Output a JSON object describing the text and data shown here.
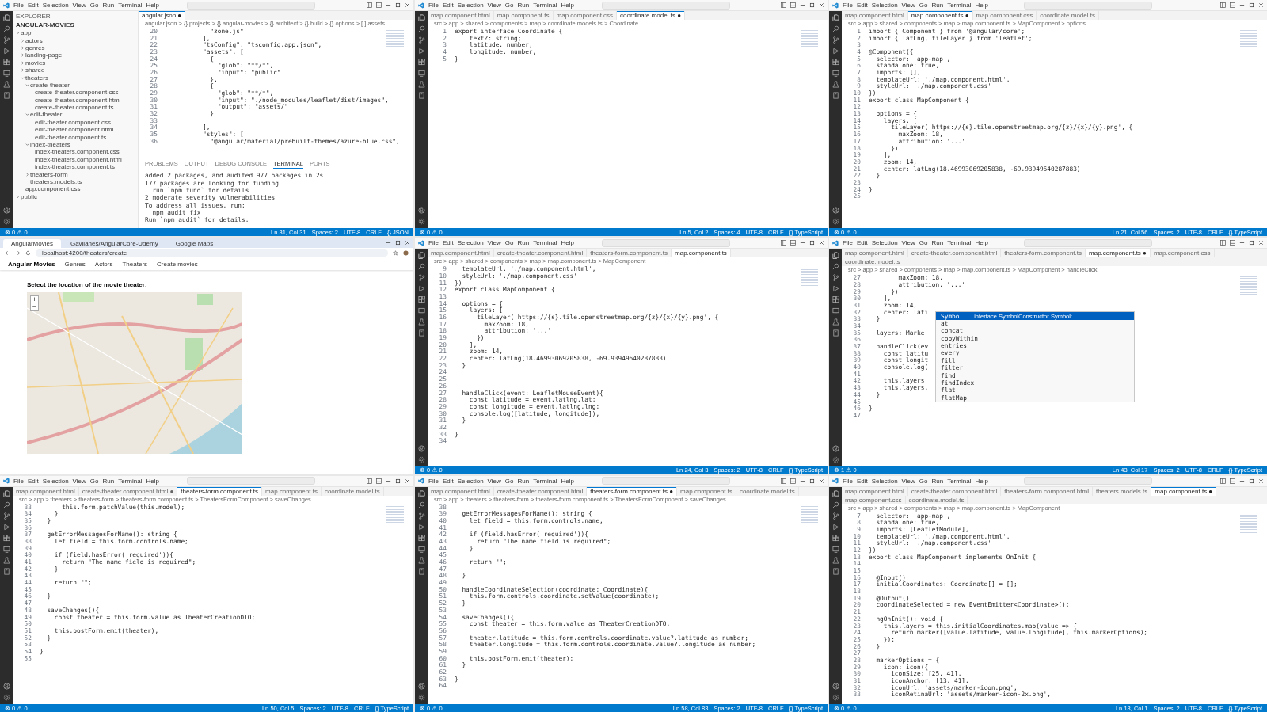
{
  "tiles": [
    {
      "kind": "editor",
      "menu": [
        "File",
        "Edit",
        "Selection",
        "View",
        "Go",
        "Run",
        "Terminal",
        "Help"
      ],
      "sidebar": {
        "title": "EXPLORER",
        "root": "ANGULAR-MOVIES",
        "items": [
          {
            "label": "app",
            "expanded": true,
            "children": [
              {
                "label": "actors",
                "expanded": false
              },
              {
                "label": "genres",
                "expanded": false
              },
              {
                "label": "landing-page",
                "expanded": false
              },
              {
                "label": "movies",
                "expanded": false
              },
              {
                "label": "shared",
                "expanded": false
              },
              {
                "label": "theaters",
                "expanded": true,
                "children": [
                  {
                    "label": "create-theater",
                    "expanded": true,
                    "children": [
                      {
                        "label": "create-theater.component.css"
                      },
                      {
                        "label": "create-theater.component.html"
                      },
                      {
                        "label": "create-theater.component.ts"
                      }
                    ]
                  },
                  {
                    "label": "edit-theater",
                    "expanded": true,
                    "children": [
                      {
                        "label": "edit-theater.component.css"
                      },
                      {
                        "label": "edit-theater.component.html"
                      },
                      {
                        "label": "edit-theater.component.ts"
                      }
                    ]
                  },
                  {
                    "label": "index-theaters",
                    "expanded": true,
                    "children": [
                      {
                        "label": "index-theaters.component.css"
                      },
                      {
                        "label": "index-theaters.component.html"
                      },
                      {
                        "label": "index-theaters.component.ts"
                      }
                    ]
                  },
                  {
                    "label": "theaters-form",
                    "expanded": false
                  },
                  {
                    "label": "theaters.models.ts"
                  }
                ]
              },
              {
                "label": "app.component.css"
              }
            ]
          },
          {
            "label": "public",
            "expanded": false
          }
        ]
      },
      "tabs": [
        {
          "label": "angular.json ●",
          "selected": true
        }
      ],
      "breadcrumb": "angular.json > {} projects > {} angular-movies > {} architect > {} build > {} options > [ ] assets",
      "lines": [
        {
          "n": "20",
          "text": "            \"zone.js\""
        },
        {
          "n": "21",
          "text": "          ],"
        },
        {
          "n": "22",
          "text": "          \"tsConfig\": \"tsconfig.app.json\","
        },
        {
          "n": "23",
          "text": "          \"assets\": ["
        },
        {
          "n": "24",
          "text": "            {"
        },
        {
          "n": "25",
          "text": "              \"glob\": \"**/*\","
        },
        {
          "n": "26",
          "text": "              \"input\": \"public\""
        },
        {
          "n": "27",
          "text": "            },"
        },
        {
          "n": "28",
          "text": "            {"
        },
        {
          "n": "29",
          "text": "              \"glob\": \"**/*\","
        },
        {
          "n": "30",
          "text": "              \"input\": \"./node_modules/leaflet/dist/images\","
        },
        {
          "n": "31",
          "text": "              \"output\": \"assets/\""
        },
        {
          "n": "32",
          "text": "            }"
        },
        {
          "n": "33"
        },
        {
          "n": "34",
          "text": "          ],"
        },
        {
          "n": "35",
          "text": "          \"styles\": ["
        },
        {
          "n": "36",
          "text": "            \"@angular/material/prebuilt-themes/azure-blue.css\","
        }
      ],
      "panel": {
        "tabs": [
          {
            "label": "PROBLEMS",
            "selected": false
          },
          {
            "label": "OUTPUT",
            "selected": false
          },
          {
            "label": "DEBUG CONSOLE",
            "selected": false
          },
          {
            "label": "TERMINAL",
            "selected": true
          },
          {
            "label": "PORTS",
            "selected": false
          }
        ],
        "lines": [
          "added 2 packages, and audited 977 packages in 2s",
          "177 packages are looking for funding",
          "  run `npm fund` for details",
          "2 moderate severity vulnerabilities",
          "To address all issues, run:",
          "  npm audit fix",
          "Run `npm audit` for details."
        ]
      },
      "status_left": [
        "⊗ 0 ⚠ 0"
      ],
      "status_right": [
        "Ln 31, Col 31",
        "Spaces: 2",
        "UTF-8",
        "CRLF",
        "{} JSON"
      ]
    },
    {
      "kind": "editor",
      "menu": [
        "File",
        "Edit",
        "Selection",
        "View",
        "Go",
        "Run",
        "Terminal",
        "Help"
      ],
      "tabs": [
        {
          "label": "map.component.html",
          "selected": false
        },
        {
          "label": "map.component.ts",
          "selected": false
        },
        {
          "label": "map.component.css",
          "selected": false
        },
        {
          "label": "coordinate.model.ts ●",
          "selected": true
        }
      ],
      "breadcrumb": "src > app > shared > components > map > coordinate.models.ts > Coordinate",
      "lines": [
        {
          "n": "1",
          "text": "export interface Coordinate {"
        },
        {
          "n": "2",
          "text": "    text?: string;"
        },
        {
          "n": "3",
          "text": "    latitude: number;"
        },
        {
          "n": "4",
          "text": "    longitude: number;"
        },
        {
          "n": "5",
          "text": "}"
        }
      ],
      "status_left": [
        "⊗ 0 ⚠ 0"
      ],
      "status_right": [
        "Ln 5, Col 2",
        "Spaces: 4",
        "UTF-8",
        "CRLF",
        "{} TypeScript"
      ]
    },
    {
      "kind": "editor",
      "menu": [
        "File",
        "Edit",
        "Selection",
        "View",
        "Go",
        "Run",
        "Terminal",
        "Help"
      ],
      "tabs": [
        {
          "label": "map.component.html",
          "selected": false
        },
        {
          "label": "map.component.ts ●",
          "selected": true
        },
        {
          "label": "map.component.css",
          "selected": false
        },
        {
          "label": "coordinate.model.ts",
          "selected": false
        }
      ],
      "breadcrumb": "src > app > shared > components > map > map.component.ts > MapComponent > options",
      "lines": [
        {
          "n": "1",
          "text": "import { Component } from '@angular/core';"
        },
        {
          "n": "2",
          "text": "import { latLng, tileLayer } from 'leaflet';"
        },
        {
          "n": "3"
        },
        {
          "n": "4",
          "text": "@Component({"
        },
        {
          "n": "5",
          "text": "  selector: 'app-map',"
        },
        {
          "n": "6",
          "text": "  standalone: true,"
        },
        {
          "n": "7",
          "text": "  imports: [],"
        },
        {
          "n": "8",
          "text": "  templateUrl: './map.component.html',"
        },
        {
          "n": "9",
          "text": "  styleUrl: './map.component.css'"
        },
        {
          "n": "10",
          "text": "})"
        },
        {
          "n": "11",
          "text": "export class MapComponent {"
        },
        {
          "n": "12"
        },
        {
          "n": "13",
          "text": "  options = {"
        },
        {
          "n": "14",
          "text": "    layers: ["
        },
        {
          "n": "15",
          "text": "      tileLayer('https://{s}.tile.openstreetmap.org/{z}/{x}/{y}.png', {"
        },
        {
          "n": "16",
          "text": "        maxZoom: 18,"
        },
        {
          "n": "17",
          "text": "        attribution: '...'"
        },
        {
          "n": "18",
          "text": "      })"
        },
        {
          "n": "19",
          "text": "    ],"
        },
        {
          "n": "20",
          "text": "    zoom: 14,"
        },
        {
          "n": "21",
          "text": "    center: latLng(18.46993069205838, -69.93949640287883)"
        },
        {
          "n": "22",
          "text": "  }"
        },
        {
          "n": "23"
        },
        {
          "n": "24",
          "text": "}"
        },
        {
          "n": "25"
        }
      ],
      "status_left": [
        "⊗ 0 ⚠ 0"
      ],
      "status_right": [
        "Ln 21, Col 56",
        "Spaces: 2",
        "UTF-8",
        "CRLF",
        "{} TypeScript"
      ]
    },
    {
      "kind": "browser",
      "tabs": [
        {
          "label": "AngularMovies",
          "selected": true
        },
        {
          "label": "Gavilanes/AngularCore-Udemy",
          "selected": false
        },
        {
          "label": "Google Maps",
          "selected": false
        }
      ],
      "url": "localhost:4200/theaters/create",
      "brand": "Angular Movies",
      "nav": [
        "Genres",
        "Actors",
        "Theaters",
        "Create movies"
      ],
      "heading": "Select the location of the movie theater:",
      "zoom_controls": [
        "+",
        "−"
      ]
    },
    {
      "kind": "editor",
      "menu": [
        "File",
        "Edit",
        "Selection",
        "View",
        "Go",
        "Run",
        "Terminal",
        "Help"
      ],
      "tabs": [
        {
          "label": "map.component.html",
          "selected": false
        },
        {
          "label": "create-theater.component.html",
          "selected": false
        },
        {
          "label": "theaters-form.component.ts",
          "selected": false
        },
        {
          "label": "map.component.ts",
          "selected": true
        }
      ],
      "breadcrumb": "src > app > shared > components > map > map.component.ts > MapComponent",
      "lines": [
        {
          "n": "9",
          "text": "  templateUrl: './map.component.html',"
        },
        {
          "n": "10",
          "text": "  styleUrl: './map.component.css'"
        },
        {
          "n": "11",
          "text": "})"
        },
        {
          "n": "12",
          "text": "export class MapComponent {"
        },
        {
          "n": "13"
        },
        {
          "n": "14",
          "text": "  options = {"
        },
        {
          "n": "15",
          "text": "    layers: ["
        },
        {
          "n": "16",
          "text": "      tileLayer('https://{s}.tile.openstreetmap.org/{z}/{x}/{y}.png', {"
        },
        {
          "n": "17",
          "text": "        maxZoom: 18,"
        },
        {
          "n": "18",
          "text": "        attribution: '...'"
        },
        {
          "n": "19",
          "text": "      })"
        },
        {
          "n": "20",
          "text": "    ],"
        },
        {
          "n": "21",
          "text": "    zoom: 14,"
        },
        {
          "n": "22",
          "text": "    center: latLng(18.46993069205838, -69.93949640287883)"
        },
        {
          "n": "23",
          "text": "  }"
        },
        {
          "n": "24"
        },
        {
          "n": "25"
        },
        {
          "n": "26"
        },
        {
          "n": "27",
          "text": "  handleClick(event: LeafletMouseEvent){"
        },
        {
          "n": "28",
          "text": "    const latitude = event.latlng.lat;"
        },
        {
          "n": "29",
          "text": "    const longitude = event.latlng.lng;"
        },
        {
          "n": "30",
          "text": "    console.log([latitude, longitude]);"
        },
        {
          "n": "31",
          "text": "  }"
        },
        {
          "n": "32"
        },
        {
          "n": "33",
          "text": "}"
        },
        {
          "n": "34"
        }
      ],
      "status_left": [
        "⊗ 0 ⚠ 0"
      ],
      "status_right": [
        "Ln 24, Col 3",
        "Spaces: 2",
        "UTF-8",
        "CRLF",
        "{} TypeScript"
      ]
    },
    {
      "kind": "editor",
      "menu": [
        "File",
        "Edit",
        "Selection",
        "View",
        "Go",
        "Run",
        "Terminal",
        "Help"
      ],
      "tabs": [
        {
          "label": "map.component.html",
          "selected": false
        },
        {
          "label": "create-theater.component.html",
          "selected": false
        },
        {
          "label": "theaters-form.component.ts",
          "selected": false
        },
        {
          "label": "map.component.ts ●",
          "selected": true
        },
        {
          "label": "map.component.css",
          "selected": false
        },
        {
          "label": "coordinate.model.ts",
          "selected": false
        }
      ],
      "breadcrumb": "src > app > shared > components > map > map.component.ts > MapComponent > handleClick",
      "lines": [
        {
          "n": "27",
          "text": "        maxZoom: 18,"
        },
        {
          "n": "28",
          "text": "        attribution: '...'"
        },
        {
          "n": "29",
          "text": "      })"
        },
        {
          "n": "30",
          "text": "    ],"
        },
        {
          "n": "31",
          "text": "    zoom: 14,"
        },
        {
          "n": "32",
          "text": "    center: lati"
        },
        {
          "n": "33",
          "text": "  }"
        },
        {
          "n": "34"
        },
        {
          "n": "35",
          "text": "  layers: Marke"
        },
        {
          "n": "36"
        },
        {
          "n": "37",
          "text": "  handleClick(ev"
        },
        {
          "n": "38",
          "text": "    const latitu"
        },
        {
          "n": "39",
          "text": "    const longit"
        },
        {
          "n": "40",
          "text": "    console.log("
        },
        {
          "n": "41"
        },
        {
          "n": "42",
          "text": "    this.layers"
        },
        {
          "n": "43",
          "text": "    this.layers."
        },
        {
          "n": "44",
          "text": "  }"
        },
        {
          "n": "45"
        },
        {
          "n": "46",
          "text": "}"
        },
        {
          "n": "47"
        }
      ],
      "suggest": {
        "items": [
          {
            "label": "Symbol",
            "detail": "interface SymbolConstructor Symbol: ...",
            "selected": true
          },
          {
            "label": "at",
            "selected": false
          },
          {
            "label": "concat",
            "selected": false
          },
          {
            "label": "copyWithin",
            "selected": false
          },
          {
            "label": "entries",
            "selected": false
          },
          {
            "label": "every",
            "selected": false
          },
          {
            "label": "fill",
            "selected": false
          },
          {
            "label": "filter",
            "selected": false
          },
          {
            "label": "find",
            "selected": false
          },
          {
            "label": "findIndex",
            "selected": false
          },
          {
            "label": "flat",
            "selected": false
          },
          {
            "label": "flatMap",
            "selected": false
          }
        ]
      },
      "status_left": [
        "⊗ 1 ⚠ 0"
      ],
      "status_right": [
        "Ln 43, Col 17",
        "Spaces: 2",
        "UTF-8",
        "CRLF",
        "{} TypeScript"
      ]
    },
    {
      "kind": "editor",
      "menu": [
        "File",
        "Edit",
        "Selection",
        "View",
        "Go",
        "Run",
        "Terminal",
        "Help"
      ],
      "tabs": [
        {
          "label": "map.component.html",
          "selected": false
        },
        {
          "label": "create-theater.component.html ●",
          "selected": false
        },
        {
          "label": "theaters-form.component.ts",
          "selected": true
        },
        {
          "label": "map.component.ts",
          "selected": false
        },
        {
          "label": "coordinate.model.ts",
          "selected": false
        }
      ],
      "breadcrumb": "src > app > theaters > theaters-form > theaters-form.component.ts > TheatersFormComponent > saveChanges",
      "lines": [
        {
          "n": "33",
          "text": "      this.form.patchValue(this.model);"
        },
        {
          "n": "34",
          "text": "    }"
        },
        {
          "n": "35",
          "text": "  }"
        },
        {
          "n": "36"
        },
        {
          "n": "37",
          "text": "  getErrorMessagesForName(): string {"
        },
        {
          "n": "38",
          "text": "    let field = this.form.controls.name;"
        },
        {
          "n": "39"
        },
        {
          "n": "40",
          "text": "    if (field.hasError('required')){"
        },
        {
          "n": "41",
          "text": "      return \"The name field is required\";"
        },
        {
          "n": "42",
          "text": "    }"
        },
        {
          "n": "43"
        },
        {
          "n": "44",
          "text": "    return \"\";"
        },
        {
          "n": "45"
        },
        {
          "n": "46",
          "text": "  }"
        },
        {
          "n": "47"
        },
        {
          "n": "48",
          "text": "  saveChanges(){"
        },
        {
          "n": "49",
          "text": "    const theater = this.form.value as TheaterCreationDTO;"
        },
        {
          "n": "50"
        },
        {
          "n": "51",
          "text": "    this.postForm.emit(theater);"
        },
        {
          "n": "52",
          "text": "  }"
        },
        {
          "n": "53"
        },
        {
          "n": "54",
          "text": "}"
        },
        {
          "n": "55"
        }
      ],
      "status_left": [
        "⊗ 0 ⚠ 0"
      ],
      "status_right": [
        "Ln 50, Col 5",
        "Spaces: 2",
        "UTF-8",
        "CRLF",
        "{} TypeScript"
      ]
    },
    {
      "kind": "editor",
      "menu": [
        "File",
        "Edit",
        "Selection",
        "View",
        "Go",
        "Run",
        "Terminal",
        "Help"
      ],
      "tabs": [
        {
          "label": "map.component.html",
          "selected": false
        },
        {
          "label": "create-theater.component.html",
          "selected": false
        },
        {
          "label": "theaters-form.component.ts ●",
          "selected": true
        },
        {
          "label": "map.component.ts",
          "selected": false
        },
        {
          "label": "coordinate.model.ts",
          "selected": false
        }
      ],
      "breadcrumb": "src > app > theaters > theaters-form > theaters-form.component.ts > TheatersFormComponent > saveChanges",
      "lines": [
        {
          "n": "38"
        },
        {
          "n": "39",
          "text": "  getErrorMessagesForName(): string {"
        },
        {
          "n": "40",
          "text": "    let field = this.form.controls.name;"
        },
        {
          "n": "41"
        },
        {
          "n": "42",
          "text": "    if (field.hasError('required')){"
        },
        {
          "n": "43",
          "text": "      return \"The name field is required\";"
        },
        {
          "n": "44",
          "text": "    }"
        },
        {
          "n": "45"
        },
        {
          "n": "46",
          "text": "    return \"\";"
        },
        {
          "n": "47"
        },
        {
          "n": "48",
          "text": "  }"
        },
        {
          "n": "49"
        },
        {
          "n": "50",
          "text": "  handleCoordinateSelection(coordinate: Coordinate){"
        },
        {
          "n": "51",
          "text": "    this.form.controls.coordinate.setValue(coordinate);"
        },
        {
          "n": "52",
          "text": "  }"
        },
        {
          "n": "53"
        },
        {
          "n": "54",
          "text": "  saveChanges(){"
        },
        {
          "n": "55",
          "text": "    const theater = this.form.value as TheaterCreationDTO;"
        },
        {
          "n": "56"
        },
        {
          "n": "57",
          "text": "    theater.latitude = this.form.controls.coordinate.value?.latitude as number;"
        },
        {
          "n": "58",
          "text": "    theater.longitude = this.form.controls.coordinate.value?.longitude as number;"
        },
        {
          "n": "59"
        },
        {
          "n": "60",
          "text": "    this.postForm.emit(theater);"
        },
        {
          "n": "61",
          "text": "  }"
        },
        {
          "n": "62"
        },
        {
          "n": "63",
          "text": "}"
        },
        {
          "n": "64"
        }
      ],
      "status_left": [
        "⊗ 0 ⚠ 0"
      ],
      "status_right": [
        "Ln 58, Col 83",
        "Spaces: 2",
        "UTF-8",
        "CRLF",
        "{} TypeScript"
      ]
    },
    {
      "kind": "editor",
      "menu": [
        "File",
        "Edit",
        "Selection",
        "View",
        "Go",
        "Run",
        "Terminal",
        "Help"
      ],
      "tabs": [
        {
          "label": "map.component.html",
          "selected": false
        },
        {
          "label": "create-theater.component.html",
          "selected": false
        },
        {
          "label": "theaters-form.component.html",
          "selected": false
        },
        {
          "label": "theaters.models.ts",
          "selected": false
        },
        {
          "label": "map.component.ts ●",
          "selected": true
        },
        {
          "label": "map.component.css",
          "selected": false
        },
        {
          "label": "coordinate.model.ts",
          "selected": false
        }
      ],
      "breadcrumb": "src > app > shared > components > map > map.component.ts > MapComponent",
      "lines": [
        {
          "n": "7",
          "text": "  selector: 'app-map',"
        },
        {
          "n": "8",
          "text": "  standalone: true,"
        },
        {
          "n": "9",
          "text": "  imports: [LeafletModule],"
        },
        {
          "n": "10",
          "text": "  templateUrl: './map.component.html',"
        },
        {
          "n": "11",
          "text": "  styleUrl: './map.component.css'"
        },
        {
          "n": "12",
          "text": "})"
        },
        {
          "n": "13",
          "text": "export class MapComponent implements OnInit {"
        },
        {
          "n": "14"
        },
        {
          "n": "15"
        },
        {
          "n": "16",
          "text": "  @Input()"
        },
        {
          "n": "17",
          "text": "  initialCoordinates: Coordinate[] = [];"
        },
        {
          "n": "18"
        },
        {
          "n": "19",
          "text": "  @Output()"
        },
        {
          "n": "20",
          "text": "  coordinateSelected = new EventEmitter<Coordinate>();"
        },
        {
          "n": "21"
        },
        {
          "n": "22",
          "text": "  ngOnInit(): void {"
        },
        {
          "n": "23",
          "text": "    this.layers = this.initialCoordinates.map(value => {"
        },
        {
          "n": "24",
          "text": "      return marker([value.latitude, value.longitude], this.markerOptions);"
        },
        {
          "n": "25",
          "text": "    });"
        },
        {
          "n": "26",
          "text": "  }"
        },
        {
          "n": "27"
        },
        {
          "n": "28",
          "text": "  markerOptions = {"
        },
        {
          "n": "29",
          "text": "    icon: icon({"
        },
        {
          "n": "30",
          "text": "      iconSize: [25, 41],"
        },
        {
          "n": "31",
          "text": "      iconAnchor: [13, 41],"
        },
        {
          "n": "32",
          "text": "      iconUrl: 'assets/marker-icon.png',"
        },
        {
          "n": "33",
          "text": "      iconRetinaUrl: 'assets/marker-icon-2x.png',"
        }
      ],
      "status_left": [
        "⊗ 0 ⚠ 0"
      ],
      "status_right": [
        "Ln 18, Col 1",
        "Spaces: 2",
        "UTF-8",
        "CRLF",
        "{} TypeScript"
      ]
    }
  ]
}
